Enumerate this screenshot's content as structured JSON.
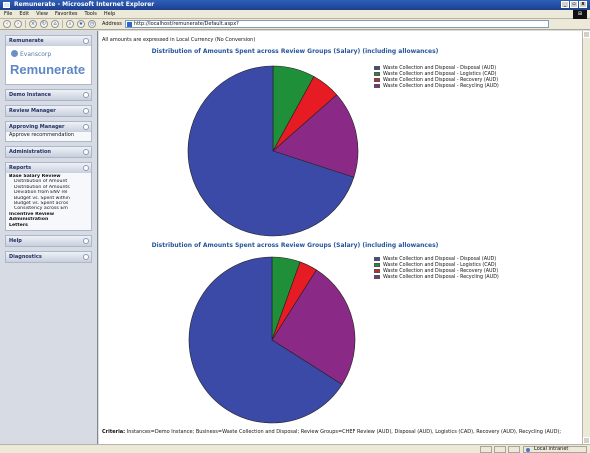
{
  "window": {
    "title": "Remunerate - Microsoft Internet Explorer",
    "controls": [
      "_",
      "▫",
      "x"
    ]
  },
  "menus": [
    "File",
    "Edit",
    "View",
    "Favorites",
    "Tools",
    "Help"
  ],
  "address": {
    "label": "Address",
    "url": "http://localhost/remunerate/Default.aspx?"
  },
  "sidebar": {
    "remunerate_header": "Remunerate",
    "brand_small": "Evanscorp",
    "brand_large": "Remunerate",
    "demo_instance": "Demo Instance",
    "review_manager": "Review Manager",
    "approving_manager": "Approving Manager",
    "approve_recommendation": "Approve recommendation",
    "administration": "Administration",
    "reports": "Reports",
    "report_items": [
      "Base Salary Review",
      "Distribution of Amount",
      "Distribution of Amounts",
      "Deviation from ENV rel",
      "Budget vs. Spent within",
      "Budget vs. Spent acros",
      "Consistency across Em",
      "Incentive Review",
      "Administration",
      "Letters"
    ],
    "help": "Help",
    "diagnostics": "Diagnostics"
  },
  "main": {
    "note": "All amounts are expressed in Local Currency (No Conversion)",
    "criteria_label": "Criteria:",
    "criteria_text": "Instances=Demo Instance; Business=Waste Collection and Disposal; Review Groups=CHEF Review (AUD), Disposal (AUD), Logistics (CAD), Recovery (AUD), Recycling (AUD);"
  },
  "colors": {
    "disposal": "#3b4aa6",
    "logistics": "#1f8f3a",
    "recovery": "#e61b23",
    "recycling": "#8b2a86"
  },
  "chart_data": [
    {
      "type": "pie",
      "title": "Distribution of Amounts Spent across Review Groups (Salary) (including allowances)",
      "series": [
        {
          "name": "Waste Collection and Disposal - Disposal (AUD)",
          "value": 70.0,
          "color": "#3b4aa6"
        },
        {
          "name": "Waste Collection and Disposal - Logistics (CAD)",
          "value": 8.0,
          "color": "#1f8f3a"
        },
        {
          "name": "Waste Collection and Disposal - Recovery (AUD)",
          "value": 5.5,
          "color": "#e61b23"
        },
        {
          "name": "Waste Collection and Disposal - Recycling (AUD)",
          "value": 16.5,
          "color": "#8b2a86"
        }
      ]
    },
    {
      "type": "pie",
      "title": "Distribution of Amounts Spent across Review Groups (Salary) (including allowances)",
      "series": [
        {
          "name": "Waste Collection and Disposal - Disposal (AUD)",
          "value": 66.0,
          "color": "#3b4aa6"
        },
        {
          "name": "Waste Collection and Disposal - Logistics (CAD)",
          "value": 5.5,
          "color": "#1f8f3a"
        },
        {
          "name": "Waste Collection and Disposal - Recovery (AUD)",
          "value": 3.5,
          "color": "#e61b23"
        },
        {
          "name": "Waste Collection and Disposal - Recycling (AUD)",
          "value": 25.0,
          "color": "#8b2a86"
        }
      ]
    }
  ],
  "status": {
    "zone": "Local intranet"
  }
}
